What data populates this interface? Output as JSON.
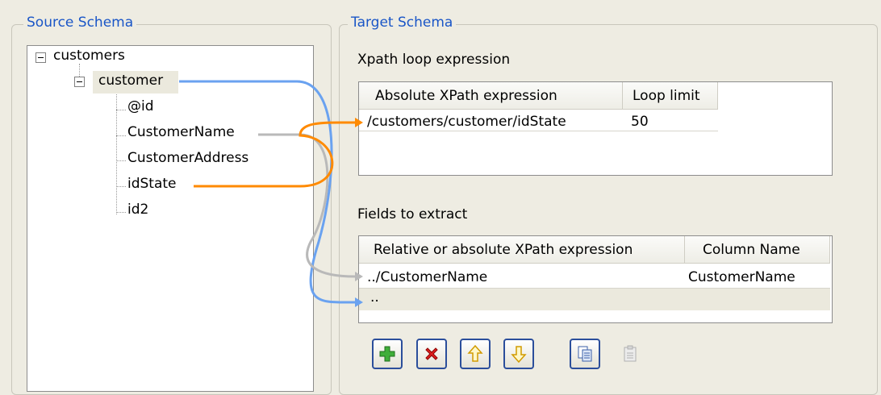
{
  "source_schema": {
    "title": "Source Schema",
    "tree": {
      "root": "customers",
      "child": "customer",
      "fields": [
        "@id",
        "CustomerName",
        "CustomerAddress",
        "idState",
        "id2"
      ]
    }
  },
  "target_schema": {
    "title": "Target Schema",
    "loop_section": {
      "label": "Xpath loop expression",
      "columns": [
        "Absolute XPath expression",
        "Loop limit"
      ],
      "rows": [
        {
          "xpath": "/customers/customer/idState",
          "limit": "50"
        }
      ]
    },
    "fields_section": {
      "label": "Fields to extract",
      "columns": [
        "Relative or absolute XPath expression",
        "Column Name"
      ],
      "rows": [
        {
          "xpath": "../CustomerName",
          "column": "CustomerName"
        },
        {
          "xpath": "..",
          "column": ""
        }
      ]
    },
    "toolbar": {
      "buttons": [
        {
          "name": "add-icon",
          "enabled": true
        },
        {
          "name": "delete-icon",
          "enabled": true
        },
        {
          "name": "move-up-icon",
          "enabled": true
        },
        {
          "name": "move-down-icon",
          "enabled": true
        },
        {
          "name": "copy-icon",
          "enabled": true
        },
        {
          "name": "paste-icon",
          "enabled": false
        }
      ]
    }
  },
  "colors": {
    "group_title": "#1a56c7",
    "link_blue": "#6aa2f0",
    "link_orange": "#ff8a00",
    "link_gray": "#b9b9b9"
  }
}
